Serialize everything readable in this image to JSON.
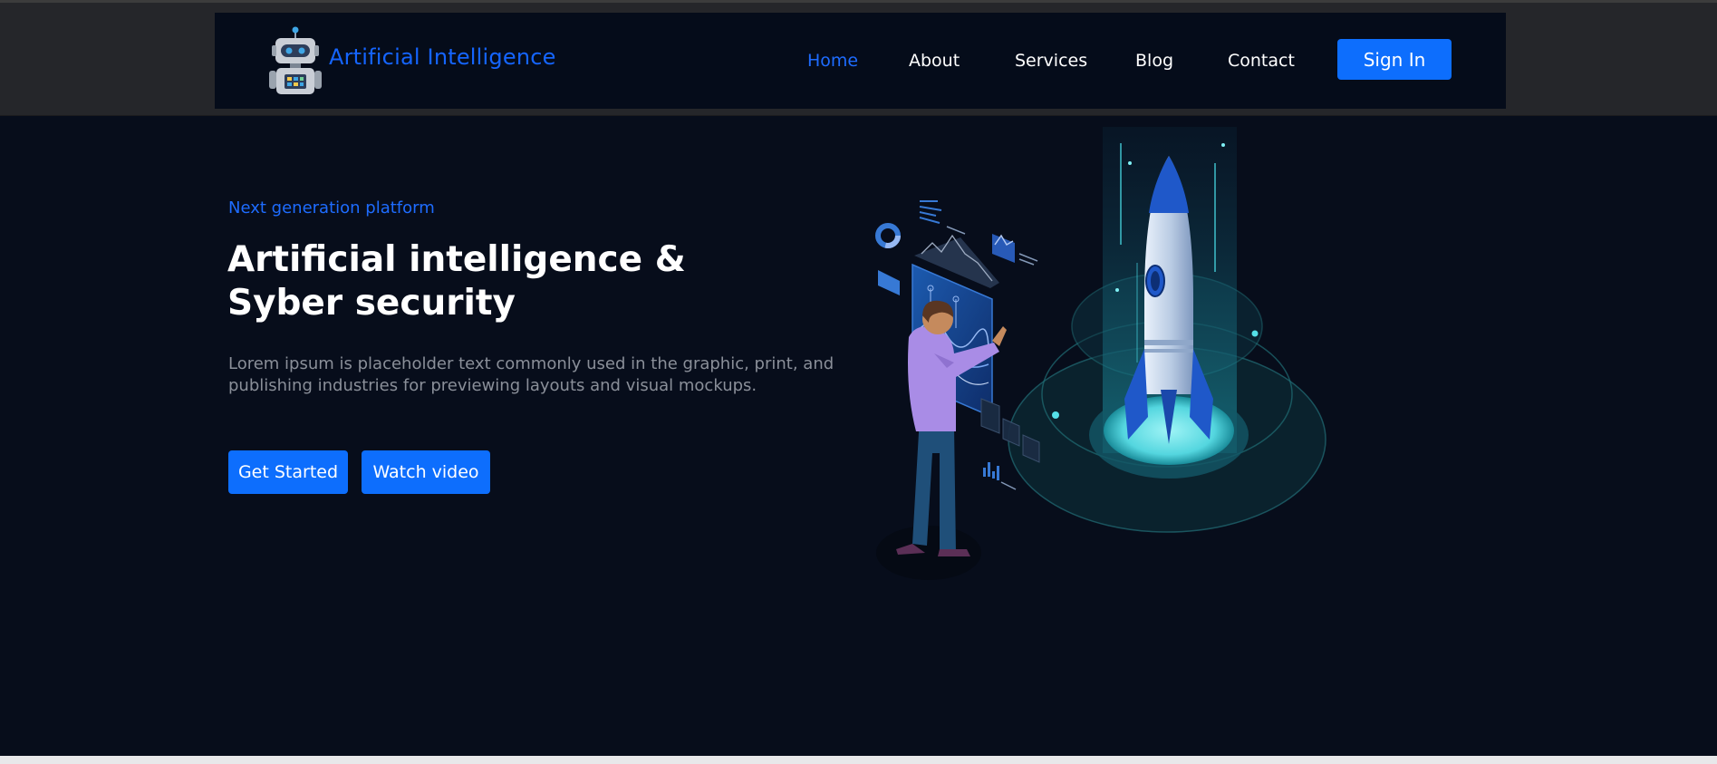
{
  "header": {
    "brand": "Artificial Intelligence",
    "logo_icon": "robot-icon",
    "nav": [
      {
        "label": "Home",
        "active": true
      },
      {
        "label": "About",
        "active": false
      },
      {
        "label": "Services",
        "active": false
      },
      {
        "label": "Blog",
        "active": false
      },
      {
        "label": "Contact",
        "active": false
      }
    ],
    "signin_label": "Sign In"
  },
  "hero": {
    "eyebrow": "Next generation platform",
    "title": "Artificial intelligence & Syber security",
    "description": "Lorem ipsum is placeholder text commonly used in the graphic, print, and publishing industries for previewing layouts and visual mockups.",
    "primary_button": "Get Started",
    "secondary_button": "Watch video",
    "illustration_icon": "rocket-launch-illustration"
  },
  "colors": {
    "accent": "#0d6efd",
    "link_active": "#1e6cff",
    "page_bg": "#070d1b",
    "nav_bg": "#050c1a"
  }
}
